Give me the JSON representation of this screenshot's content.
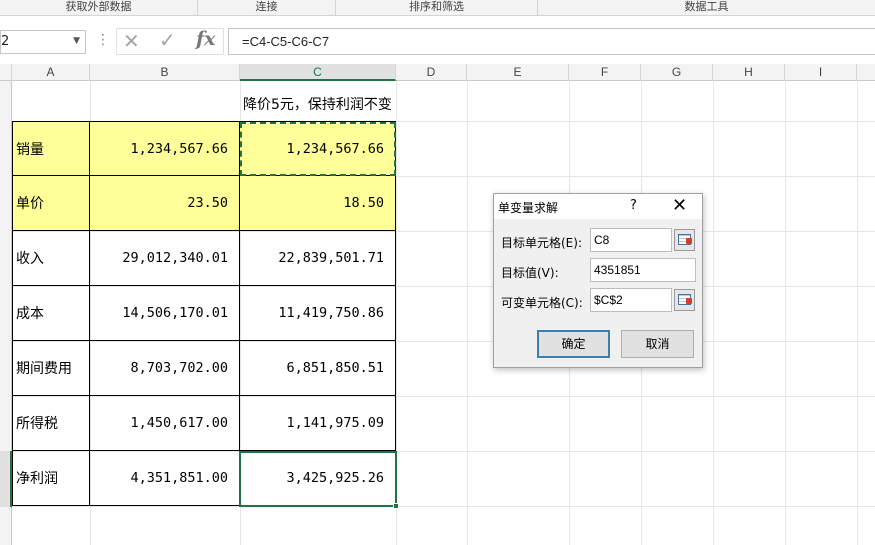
{
  "ribbon": {
    "groups": [
      "获取外部数据",
      "连接",
      "排序和筛选",
      "数据工具"
    ]
  },
  "formula_bar": {
    "name_box_value": "2",
    "formula": "=C4-C5-C6-C7",
    "icons": [
      "cancel-icon",
      "enter-icon",
      "function-icon"
    ]
  },
  "columns": [
    "A",
    "B",
    "C",
    "D",
    "E",
    "F",
    "G",
    "H",
    "I"
  ],
  "sheet": {
    "title": "降价5元，保持利润不变",
    "rows": [
      {
        "label": "销量",
        "b": "1,234,567.66",
        "c": "1,234,567.66"
      },
      {
        "label": "单价",
        "b": "23.50",
        "c": "18.50"
      },
      {
        "label": "收入",
        "b": "29,012,340.01",
        "c": "22,839,501.71"
      },
      {
        "label": "成本",
        "b": "14,506,170.01",
        "c": "11,419,750.86"
      },
      {
        "label": "期间费用",
        "b": "8,703,702.00",
        "c": "6,851,850.51"
      },
      {
        "label": "所得税",
        "b": "1,450,617.00",
        "c": "1,141,975.09"
      },
      {
        "label": "净利润",
        "b": "4,351,851.00",
        "c": "3,425,925.26"
      }
    ],
    "highlight_color": "#ffff99",
    "accent_color": "#217346"
  },
  "dialog": {
    "title": "单变量求解",
    "help": "?",
    "close": "✕",
    "target_cell_label": "目标单元格(E):",
    "target_cell_value": "C8",
    "target_value_label": "目标值(V):",
    "target_value": "4351851",
    "changing_cell_label": "可变单元格(C):",
    "changing_cell_value": "$C$2",
    "ok_label": "确定",
    "cancel_label": "取消"
  }
}
